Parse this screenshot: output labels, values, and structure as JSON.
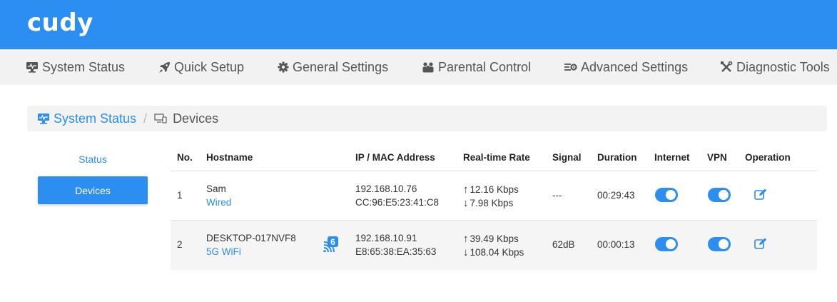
{
  "brand": {
    "logo": "cudy",
    "accent": "#2b8ef0"
  },
  "nav": {
    "items": [
      {
        "label": "System Status",
        "icon": "monitor-icon"
      },
      {
        "label": "Quick Setup",
        "icon": "rocket-icon"
      },
      {
        "label": "General Settings",
        "icon": "gear-icon"
      },
      {
        "label": "Parental Control",
        "icon": "family-icon"
      },
      {
        "label": "Advanced Settings",
        "icon": "sliders-gear-icon"
      },
      {
        "label": "Diagnostic Tools",
        "icon": "tools-icon"
      }
    ]
  },
  "breadcrumb": {
    "parent": "System Status",
    "separator": "/",
    "current": "Devices"
  },
  "side_menu": {
    "status": "Status",
    "devices": "Devices"
  },
  "table": {
    "headers": {
      "no": "No.",
      "hostname": "Hostname",
      "ip_mac": "IP / MAC Address",
      "rate": "Real-time Rate",
      "signal": "Signal",
      "duration": "Duration",
      "internet": "Internet",
      "vpn": "VPN",
      "operation": "Operation"
    },
    "rows": [
      {
        "no": "1",
        "hostname": "Sam",
        "connection": "Wired",
        "ip": "192.168.10.76",
        "mac": "CC:96:E5:23:41:C8",
        "up": "12.16 Kbps",
        "down": "7.98 Kbps",
        "signal": "---",
        "duration": "00:29:43",
        "internet": true,
        "vpn": true
      },
      {
        "no": "2",
        "hostname": "DESKTOP-017NVF8",
        "connection": "5G WiFi",
        "wifi_badge": "6",
        "ip": "192.168.10.91",
        "mac": "E8:65:38:EA:35:63",
        "up": "39.49 Kbps",
        "down": "108.04 Kbps",
        "signal": "62dB",
        "duration": "00:00:13",
        "internet": true,
        "vpn": true
      }
    ]
  }
}
